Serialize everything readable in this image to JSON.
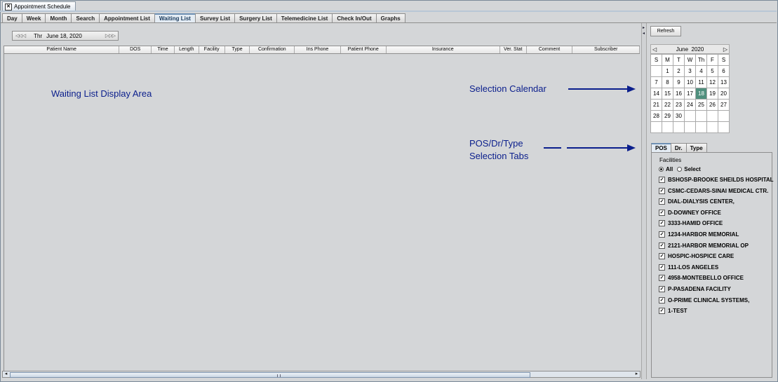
{
  "window": {
    "title": "Appointment Schedule"
  },
  "tabs": [
    "Day",
    "Week",
    "Month",
    "Search",
    "Appointment List",
    "Waiting List",
    "Survey List",
    "Surgery List",
    "Telemedicine List",
    "Check In/Out",
    "Graphs"
  ],
  "active_tab": "Waiting List",
  "date_bar": {
    "day": "Thr",
    "date": "June 18, 2020"
  },
  "columns": [
    "Patient Name",
    "DOS",
    "Time",
    "Length",
    "Facility",
    "Type",
    "Confirmation",
    "Ins Phone",
    "Patient Phone",
    "Insurance",
    "Ver. Stat",
    "Comment",
    "Subscriber"
  ],
  "annotations": {
    "display_area": "Waiting List Display Area",
    "calendar": "Selection Calendar",
    "tabs_line1": "POS/Dr/Type",
    "tabs_line2": "Selection Tabs"
  },
  "refresh_label": "Refresh",
  "calendar": {
    "month": "June",
    "year": "2020",
    "weekdays": [
      "S",
      "M",
      "T",
      "W",
      "Th",
      "F",
      "S"
    ],
    "cells": [
      "",
      "1",
      "2",
      "3",
      "4",
      "5",
      "6",
      "7",
      "8",
      "9",
      "10",
      "11",
      "12",
      "13",
      "14",
      "15",
      "16",
      "17",
      "18",
      "19",
      "20",
      "21",
      "22",
      "23",
      "24",
      "25",
      "26",
      "27",
      "28",
      "29",
      "30",
      "",
      "",
      "",
      "",
      "",
      "",
      "",
      "",
      "",
      "",
      ""
    ],
    "selected": "18",
    "selected_color": "#4f8f7d"
  },
  "panel_tabs": [
    "POS",
    "Dr.",
    "Type"
  ],
  "active_panel_tab": "POS",
  "facilities": {
    "title": "Facilities",
    "option_all": "All",
    "option_select": "Select",
    "selected_option": "All",
    "items": [
      "BSHOSP-BROOKE SHEILDS HOSPITAL",
      "CSMC-CEDARS-SINAI MEDICAL CTR.",
      "DIAL-DIALYSIS CENTER,",
      "D-DOWNEY OFFICE",
      "3333-HAMID OFFICE",
      "1234-HARBOR MEMORIAL",
      "2121-HARBOR MEMORIAL OP",
      "HOSPIC-HOSPICE CARE",
      "111-LOS ANGELES",
      "4958-MONTEBELLO OFFICE",
      "P-PASADENA FACILITY",
      "O-PRIME CLINICAL SYSTEMS,",
      "1-TEST"
    ]
  },
  "colors": {
    "annotation": "#0a1e8c",
    "active_tab_border": "#6d8fb3"
  }
}
